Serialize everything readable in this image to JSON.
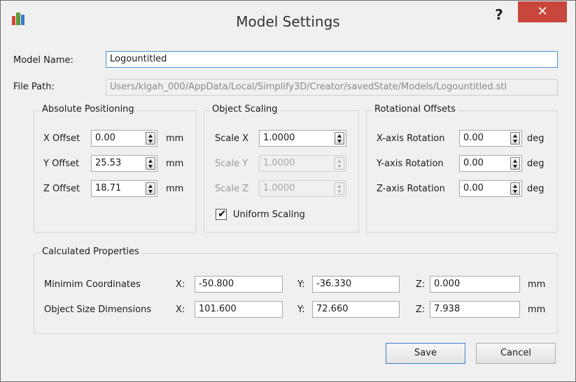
{
  "window": {
    "title": "Model Settings",
    "help_glyph": "?",
    "close_glyph": "✕"
  },
  "model": {
    "name_label": "Model Name:",
    "name_value": "Logountitled",
    "path_label": "File Path:",
    "path_value": "Users/klgah_000/AppData/Local/Simplify3D/Creator/savedState/Models/Logountitled.stl"
  },
  "absolute_positioning": {
    "title": "Absolute Positioning",
    "rows": [
      {
        "label": "X Offset",
        "value": "0.00",
        "unit": "mm"
      },
      {
        "label": "Y Offset",
        "value": "25.53",
        "unit": "mm"
      },
      {
        "label": "Z Offset",
        "value": "18.71",
        "unit": "mm"
      }
    ]
  },
  "object_scaling": {
    "title": "Object Scaling",
    "rows": [
      {
        "label": "Scale X",
        "value": "1.0000",
        "enabled": true
      },
      {
        "label": "Scale Y",
        "value": "1.0000",
        "enabled": false
      },
      {
        "label": "Scale Z",
        "value": "1.0000",
        "enabled": false
      }
    ],
    "uniform_label": "Uniform Scaling",
    "uniform_checked": true
  },
  "rotational_offsets": {
    "title": "Rotational Offsets",
    "rows": [
      {
        "label": "X-axis Rotation",
        "value": "0.00",
        "unit": "deg"
      },
      {
        "label": "Y-axis Rotation",
        "value": "0.00",
        "unit": "deg"
      },
      {
        "label": "Z-axis Rotation",
        "value": "0.00",
        "unit": "deg"
      }
    ]
  },
  "calculated": {
    "title": "Calculated Properties",
    "rows": [
      {
        "label": "Minimim Coordinates",
        "x_label": "X:",
        "x": "-50.800",
        "y_label": "Y:",
        "y": "-36.330",
        "z_label": "Z:",
        "z": "0.000",
        "unit": "mm"
      },
      {
        "label": "Object Size Dimensions",
        "x_label": "X:",
        "x": "101.600",
        "y_label": "Y:",
        "y": "72.660",
        "z_label": "Z:",
        "z": "7.938",
        "unit": "mm"
      }
    ]
  },
  "buttons": {
    "save": "Save",
    "cancel": "Cancel"
  },
  "colors": {
    "close_button": "#c9463d",
    "focus_border": "#4a8fd6",
    "window_bg": "#f0f0f0"
  }
}
